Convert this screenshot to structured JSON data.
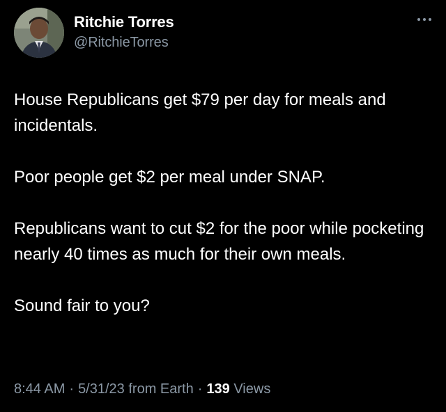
{
  "author": {
    "display_name": "Ritchie Torres",
    "handle": "@RitchieTorres"
  },
  "icons": {
    "avatar": "profile-photo",
    "more": "more-horizontal-icon"
  },
  "tweet": {
    "paragraphs": [
      "House Republicans get $79 per day for meals and incidentals.",
      "Poor people get $2 per meal under SNAP.",
      "Republicans want to cut $2 for the poor while pocketing nearly 40 times as much for their own meals.",
      "Sound fair to you?"
    ]
  },
  "meta": {
    "time": "8:44 AM",
    "separator": "·",
    "date": "5/31/23",
    "source": "from Earth",
    "views_count": "139",
    "views_label": "Views"
  },
  "colors": {
    "background": "#000000",
    "text_primary": "#ffffff",
    "text_secondary": "#8b98a5"
  }
}
